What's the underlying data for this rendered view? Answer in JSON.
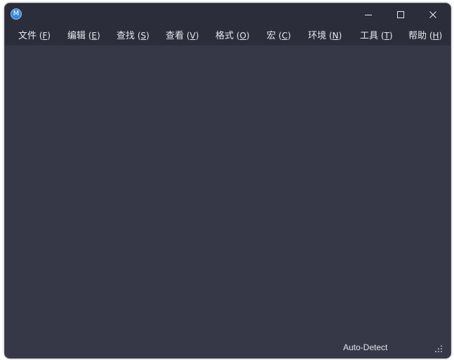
{
  "window": {
    "app_icon_letter": "M",
    "controls": {
      "minimize_icon": "minimize-icon",
      "maximize_icon": "maximize-icon",
      "close_icon": "close-icon"
    }
  },
  "menu": [
    {
      "label": "文件",
      "key_open": " (",
      "mnemonic": "F",
      "key_close": ")"
    },
    {
      "label": "编辑",
      "key_open": " (",
      "mnemonic": "E",
      "key_close": ")"
    },
    {
      "label": "查找",
      "key_open": " (",
      "mnemonic": "S",
      "key_close": ")"
    },
    {
      "label": "查看",
      "key_open": " (",
      "mnemonic": "V",
      "key_close": ")"
    },
    {
      "label": "格式",
      "key_open": " (",
      "mnemonic": "O",
      "key_close": ")"
    },
    {
      "label": "宏",
      "key_open": " (",
      "mnemonic": "C",
      "key_close": ")"
    },
    {
      "label": "环境",
      "key_open": " (",
      "mnemonic": "N",
      "key_close": ")"
    },
    {
      "label": "工具",
      "key_open": " (",
      "mnemonic": "T",
      "key_close": ")"
    },
    {
      "label": "帮助",
      "key_open": " (",
      "mnemonic": "H",
      "key_close": ")"
    }
  ],
  "status": {
    "encoding": "Auto-Detect"
  },
  "colors": {
    "titlebar": "#2b2d3a",
    "editor_background": "#363848",
    "text": "#e8e8ee",
    "app_icon": "#3f86d6"
  }
}
